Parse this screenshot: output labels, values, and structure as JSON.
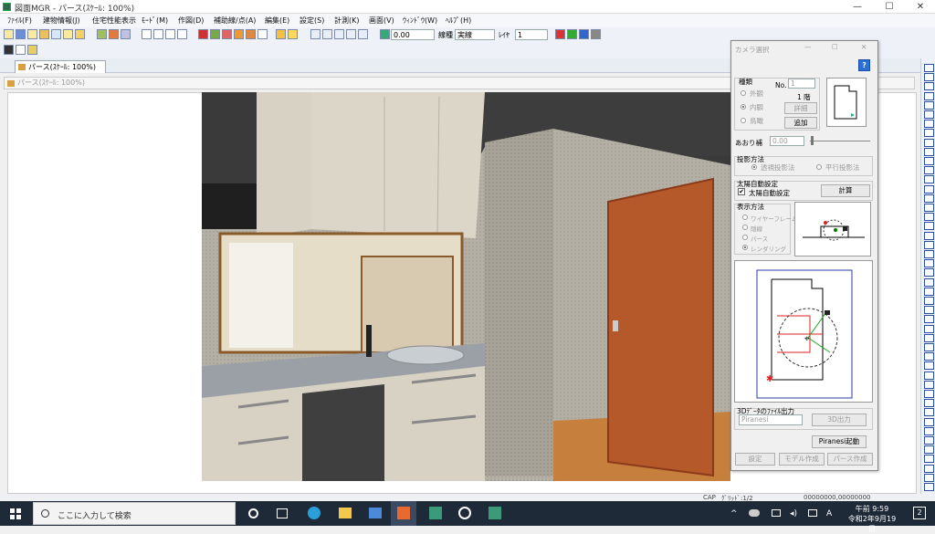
{
  "window": {
    "title": "図面MGR - パース(ｽｹｰﾙ: 100%)",
    "minimize": "—",
    "maximize": "☐",
    "close": "✕"
  },
  "menu": [
    "ﾌｧｲﾙ(F)",
    "建物情報(J)",
    "住宅性能表示",
    "ﾓｰﾄﾞ(M)",
    "作図(D)",
    "補助線/点(A)",
    "編集(E)",
    "設定(S)",
    "計測(K)",
    "画面(V)",
    "ｳｨﾝﾄﾞｳ(W)",
    "ﾍﾙﾌﾟ(H)"
  ],
  "toolbar": {
    "line_width_value": "0.00",
    "line_type_label": "線種",
    "line_type_value": "実線",
    "layer_label": "ﾚｲﾔ",
    "layer_value": "1"
  },
  "tab": {
    "label": "パース(ｽｹｰﾙ: 100%)"
  },
  "mdi": {
    "title": "パース(ｽｹｰﾙ: 100%)"
  },
  "dialog": {
    "title": "カメラ選択",
    "help": "?",
    "type_group": "種類",
    "type_options": [
      "外観",
      "内観",
      "鳥瞰"
    ],
    "type_selected": "内観",
    "no_label": "No.",
    "no_value": "1",
    "floor": "1 階",
    "detail_button": "詳細",
    "add_button": "追加",
    "tilt_label": "あおり補",
    "tilt_value": "0.00",
    "projection_group": "投影方法",
    "projection_options": [
      "透視投影法",
      "平行投影法"
    ],
    "projection_selected": "透視投影法",
    "sun_group": "太陽自動設定",
    "sun_checkbox": "太陽自動設定",
    "sun_checked": true,
    "calc_button": "計算",
    "display_group": "表示方法",
    "display_options": [
      "ワイヤーフレーム",
      "隠線",
      "パース",
      "レンダリング"
    ],
    "display_selected": "レンダリング",
    "export_group": "3Dﾃﾞｰﾀのﾌｧｲﾙ出力",
    "export_format": "Piranesi",
    "export_button": "3D出力",
    "piranesi_button": "Piranesi起動",
    "settings_button": "設定",
    "model_button": "モデル作成",
    "perspective_button": "パース作成"
  },
  "status": {
    "cap": "CAP",
    "grid": "ｸﾞﾘｯﾄﾞ:1/2",
    "coords": "00000000,00000000"
  },
  "taskbar": {
    "search_placeholder": "ここに入力して検索",
    "time": "午前 9:59",
    "date": "令和2年9月19日",
    "notifications": "2"
  },
  "colors": {
    "accent": "#0067c0",
    "door": "#b5582a",
    "counter": "#9aa0a6",
    "cabinet": "#d8d2c4",
    "wall": "#b0aca2",
    "floor": "#c77f3d"
  }
}
